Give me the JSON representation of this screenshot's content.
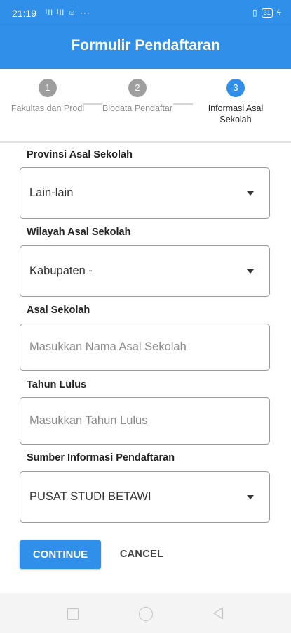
{
  "status_bar": {
    "time": "21:19",
    "left_icons": "ⵑll ⵑll ☺ ···",
    "battery": "31",
    "vibrate_icon": "vibrate-icon",
    "charging_icon": "charging-icon"
  },
  "app_bar": {
    "title": "Formulir Pendaftaran"
  },
  "stepper": {
    "steps": [
      {
        "number": "1",
        "label": "Fakultas dan Prodi",
        "state": "inactive"
      },
      {
        "number": "2",
        "label": "Biodata Pendaftar",
        "state": "inactive"
      },
      {
        "number": "3",
        "label": "Informasi Asal Sekolah",
        "state": "active"
      }
    ]
  },
  "form": {
    "provinsi": {
      "label": "Provinsi Asal Sekolah",
      "value": "Lain-lain"
    },
    "wilayah": {
      "label": "Wilayah Asal Sekolah",
      "value": "Kabupaten -"
    },
    "asal_sekolah": {
      "label": "Asal Sekolah",
      "placeholder": "Masukkan Nama Asal Sekolah"
    },
    "tahun_lulus": {
      "label": "Tahun Lulus",
      "placeholder": "Masukkan Tahun Lulus"
    },
    "sumber_info": {
      "label": "Sumber Informasi Pendaftaran",
      "value": "PUSAT STUDI BETAWI"
    }
  },
  "actions": {
    "continue_label": "CONTINUE",
    "cancel_label": "CANCEL"
  },
  "colors": {
    "primary": "#2f8fe9",
    "inactive_step": "#9e9e9e"
  }
}
